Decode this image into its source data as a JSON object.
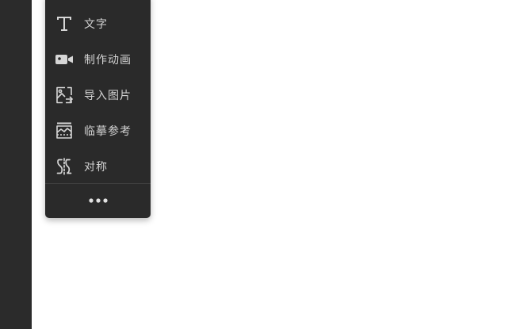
{
  "colors": {
    "rail": "#2b2b2b",
    "menu_bg": "#2a2a2a",
    "icon": "#d6d6d6",
    "label": "#d2d2d2"
  },
  "tool_menu": {
    "items": [
      {
        "label": "文字",
        "icon": "text-icon"
      },
      {
        "label": "制作动画",
        "icon": "video-camera-icon"
      },
      {
        "label": "导入图片",
        "icon": "import-image-icon"
      },
      {
        "label": "临摹参考",
        "icon": "trace-reference-icon"
      },
      {
        "label": "对称",
        "icon": "symmetry-icon"
      }
    ],
    "more": {
      "icon": "more-horizontal-icon"
    }
  }
}
